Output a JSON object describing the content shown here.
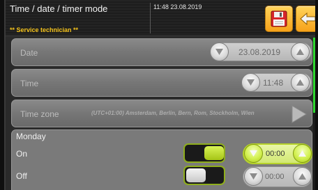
{
  "header": {
    "title": "Time / date / timer mode",
    "user_level": "** Service technician **",
    "datetime": "11:48 23.08.2019",
    "save_icon": "floppy-disk-icon",
    "back_icon": "back-arrow-icon"
  },
  "rows": {
    "date": {
      "label": "Date",
      "value": "23.08.2019"
    },
    "time": {
      "label": "Time",
      "value": "11:48"
    },
    "timezone": {
      "label": "Time zone",
      "value": "(UTC+01:00) Amsterdam, Berlin, Bern, Rom, Stockholm, Wien"
    }
  },
  "schedule": {
    "day": "Monday",
    "on": {
      "label": "On",
      "value": "00:00",
      "enabled": true
    },
    "off": {
      "label": "Off",
      "value": "00:00",
      "enabled": false
    }
  },
  "colors": {
    "accent_green": "#2fd72f",
    "user_level_yellow": "#f5c31c",
    "button_orange": "#f6a21a",
    "active_lime": "#d2f050"
  }
}
